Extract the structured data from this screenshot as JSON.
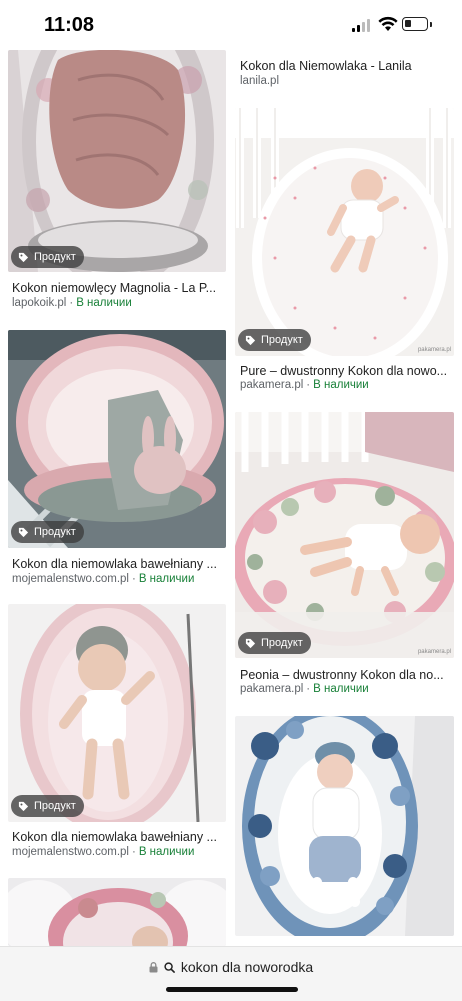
{
  "status": {
    "time": "11:08"
  },
  "badge_label": "Продукт",
  "left_column": [
    {
      "title": "Kokon niemowlęcy Magnolia - La P...",
      "source": "lapokoik.pl",
      "stock": "В наличии"
    },
    {
      "title": "Kokon dla niemowlaka bawełniany ...",
      "source": "mojemalenstwo.com.pl",
      "stock": "В наличии"
    },
    {
      "title": "Kokon dla niemowlaka bawełniany ...",
      "source": "mojemalenstwo.com.pl",
      "stock": "В наличии"
    }
  ],
  "right_column": [
    {
      "title": "Kokon dla Niemowlaka - Lanila",
      "source": "lanila.pl"
    },
    {
      "title": "Pure – dwustronny Kokon dla nowo...",
      "source": "pakamera.pl",
      "stock": "В наличии"
    },
    {
      "title": "Peonia – dwustronny Kokon dla no...",
      "source": "pakamera.pl",
      "stock": "В наличии"
    }
  ],
  "address_bar": {
    "query": "kokon dla noworodka"
  },
  "watermark": "pakamera.pl"
}
